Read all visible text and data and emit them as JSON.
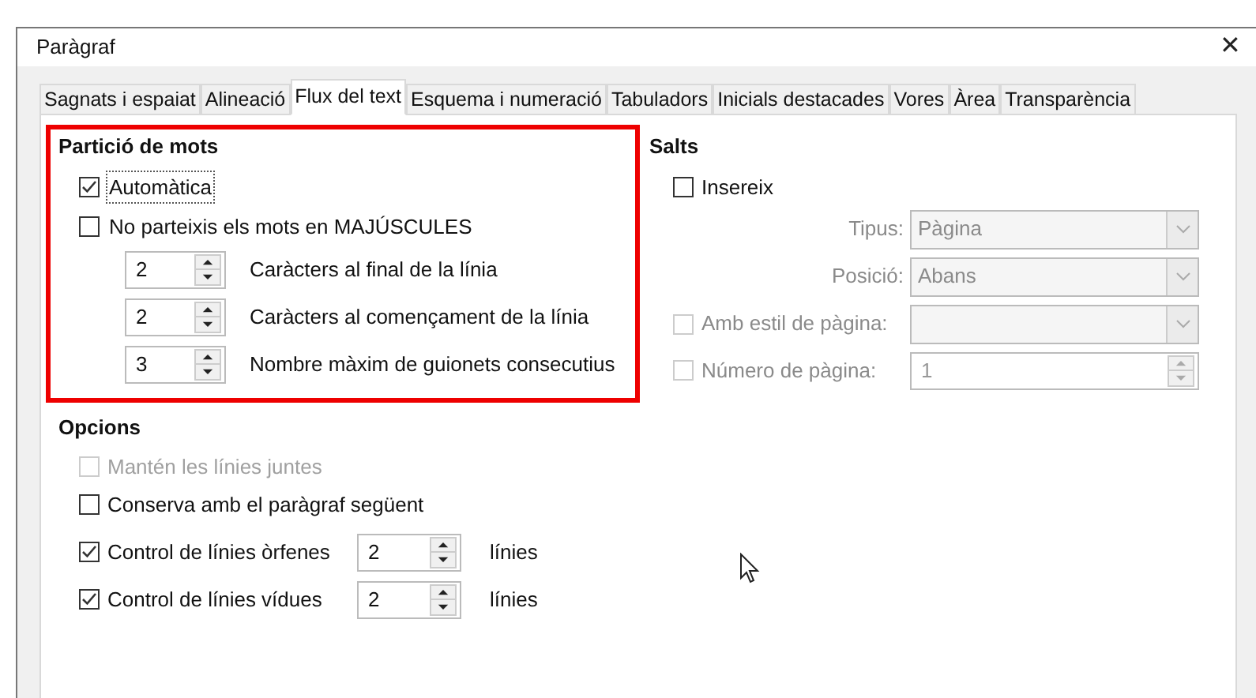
{
  "window": {
    "title": "Paràgraf",
    "close": "✕"
  },
  "tabs": [
    {
      "label": "Sagnats i espaiat",
      "selected": false
    },
    {
      "label": "Alineació",
      "selected": false
    },
    {
      "label": "Flux del text",
      "selected": true
    },
    {
      "label": "Esquema i numeració",
      "selected": false
    },
    {
      "label": "Tabuladors",
      "selected": false
    },
    {
      "label": "Inicials destacades",
      "selected": false
    },
    {
      "label": "Vores",
      "selected": false
    },
    {
      "label": "Àrea",
      "selected": false
    },
    {
      "label": "Transparència",
      "selected": false
    }
  ],
  "hyphenation": {
    "title": "Partició de mots",
    "highlighted": true,
    "options": [
      {
        "label": "Automàtica",
        "checked": true,
        "focused": true
      },
      {
        "label": "No parteixis els mots en MAJÚSCULES",
        "checked": false,
        "focused": false
      }
    ],
    "spinners": [
      {
        "value": "2",
        "label": "Caràcters al final de la línia"
      },
      {
        "value": "2",
        "label": "Caràcters al començament de la línia"
      },
      {
        "value": "3",
        "label": "Nombre màxim de guionets consecutius"
      }
    ]
  },
  "breaks": {
    "title": "Salts",
    "insert": {
      "label": "Insereix",
      "checked": false
    },
    "fields": [
      {
        "kind": "select",
        "label": "Tipus:",
        "value": "Pàgina",
        "disabled": true
      },
      {
        "kind": "select",
        "label": "Posició:",
        "value": "Abans",
        "disabled": true
      },
      {
        "kind": "check-select",
        "label": "Amb estil de pàgina:",
        "checked": false,
        "disabled": true
      },
      {
        "kind": "check-spin",
        "label": "Número de pàgina:",
        "value": "1",
        "checked": false,
        "disabled": true
      }
    ]
  },
  "options": {
    "title": "Opcions",
    "items": [
      {
        "label": "Mantén les línies juntes",
        "checked": false,
        "disabled": true
      },
      {
        "label": "Conserva amb el paràgraf següent",
        "checked": false,
        "disabled": false
      },
      {
        "label": "Control de línies òrfenes",
        "checked": true,
        "disabled": false,
        "value": "2",
        "unit": "línies"
      },
      {
        "label": "Control de línies vídues",
        "checked": true,
        "disabled": false,
        "value": "2",
        "unit": "línies"
      }
    ]
  }
}
